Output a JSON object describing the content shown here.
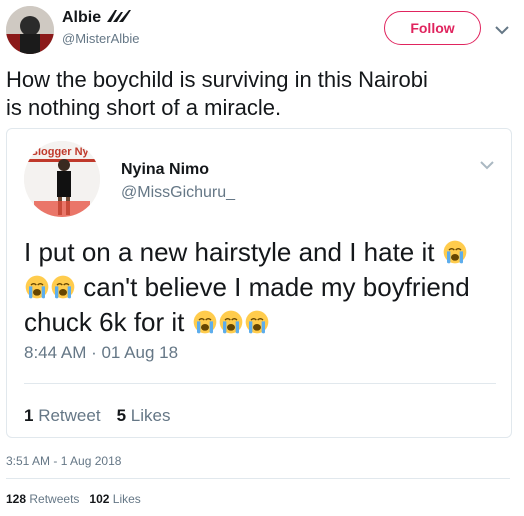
{
  "tweet": {
    "author_name": "Albie",
    "author_handle": "@MisterAlbie",
    "follow_label": "Follow",
    "text_lines": [
      "How the boychild is surviving in this Nairobi",
      "is nothing short of a miracle."
    ],
    "timestamp": "3:51 AM - 1 Aug 2018",
    "retweets_count": "128",
    "retweets_label": "Retweets",
    "likes_count": "102",
    "likes_label": "Likes"
  },
  "quoted_tweet": {
    "author_name": "Nyina Nimo",
    "author_handle": "@MissGichuru_",
    "avatar_backdrop_text": "Blogger Ny",
    "text_parts": {
      "part1": "I put on a new hairstyle and I hate it",
      "part2": "can't believe I made my boyfriend",
      "part3": "chuck 6k for it"
    },
    "emoji": "crying-face",
    "timestamp": "8:44 AM · 01 Aug 18",
    "retweets_count": "1",
    "retweets_label": "Retweet",
    "likes_count": "5",
    "likes_label": "Likes"
  },
  "colors": {
    "follow_accent": "#e0245e",
    "text_primary": "#14171a",
    "text_secondary": "#657786",
    "border": "#e1e8ed"
  }
}
